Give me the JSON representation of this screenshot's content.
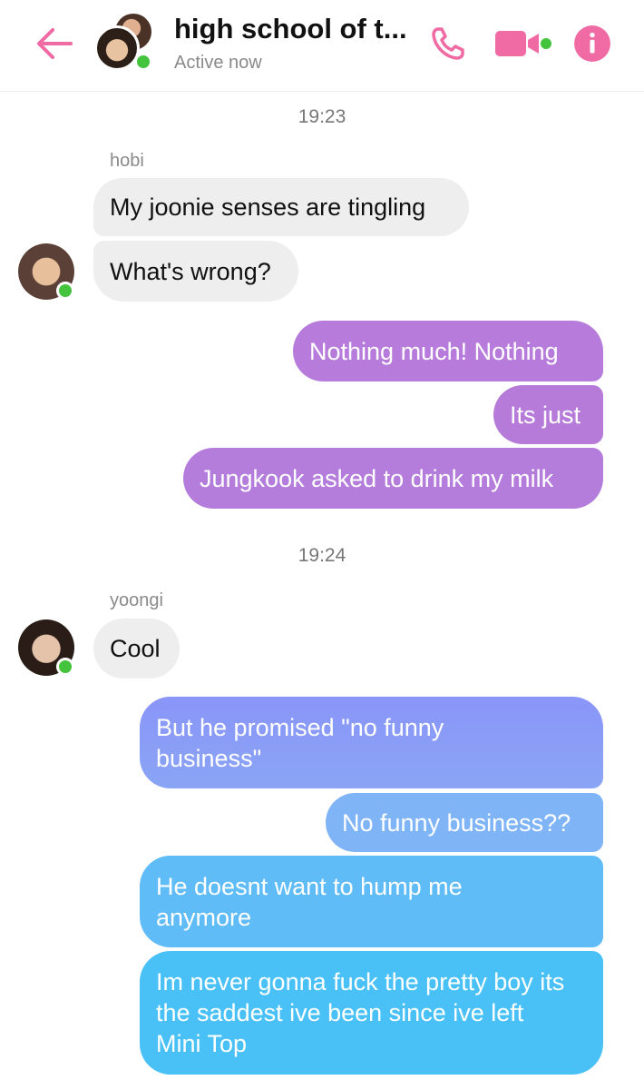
{
  "header": {
    "title": "high school of t...",
    "status": "Active now",
    "icons": [
      "back-arrow-icon",
      "phone-icon",
      "video-camera-icon",
      "info-icon"
    ],
    "accent_color": "#f06aa3"
  },
  "messages": {
    "timestamp_1": "19:23",
    "sender_hobi": "hobi",
    "hobi_1": "My joonie senses are tingling",
    "hobi_2": "What's wrong?",
    "out_1": "Nothing much! Nothing",
    "out_2": "Its just",
    "out_3": "Jungkook asked to drink my milk",
    "timestamp_2": "19:24",
    "sender_yoongi": "yoongi",
    "yoongi_1": "Cool",
    "out_4": "But he promised \"no funny business\"",
    "out_5": "No funny business??",
    "out_6": "He doesnt want to hump me anymore",
    "out_7": "Im never gonna fuck the pretty boy its the saddest ive been since ive left Mini Top"
  },
  "colors": {
    "incoming_bubble": "#eeeeee",
    "outgoing_purple": "#b67ad9",
    "outgoing_periwinkle": "#8a9cf7",
    "outgoing_blue": "#4fbcf5",
    "online_dot": "#44c43c"
  }
}
